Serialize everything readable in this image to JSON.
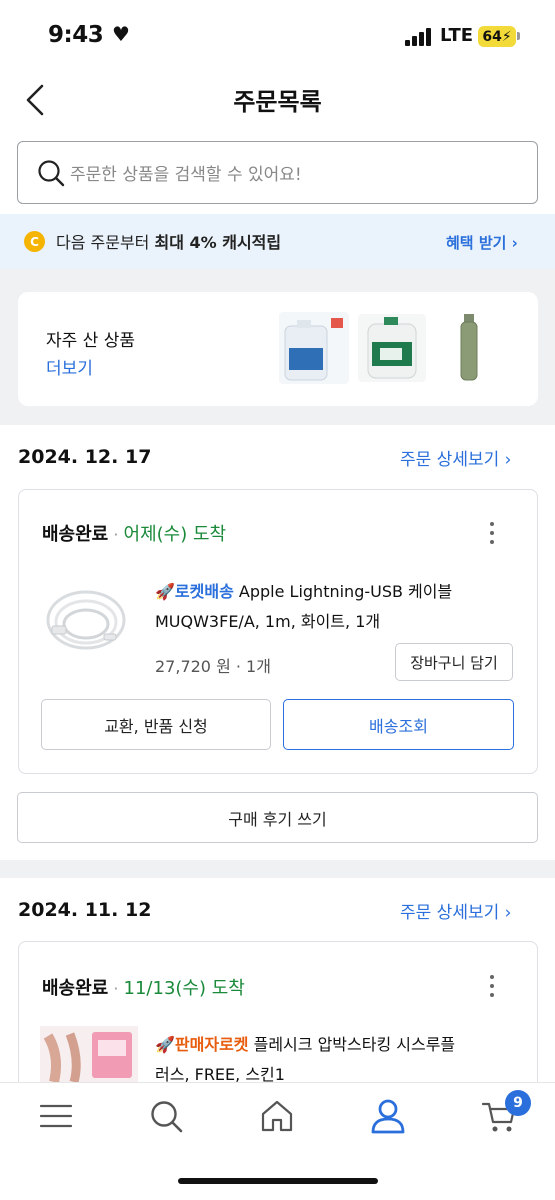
{
  "status_bar": {
    "time": "9:43",
    "network": "LTE",
    "battery": "64"
  },
  "header": {
    "title": "주문목록"
  },
  "search": {
    "placeholder": "주문한 상품을 검색할 수 있어요!"
  },
  "banner": {
    "coin": "C",
    "text_prefix": "다음 주문부터 ",
    "text_bold": "최대 4% 캐시적립",
    "link": "혜택 받기 ›"
  },
  "frequent": {
    "title": "자주 산 상품",
    "more": "더보기"
  },
  "orders": [
    {
      "date": "2024. 12. 17",
      "detail_link": "주문 상세보기 ›",
      "status": "배송완료",
      "arrival": "어제(수) 도착",
      "badge": "🚀로켓배송",
      "product_line1": " Apple Lightning-USB 케이블",
      "product_line2": "MUQW3FE/A, 1m, 화이트, 1개",
      "price": "27,720 원 · 1개",
      "cart_button": "장바구니 담기",
      "exchange_button": "교환, 반품 신청",
      "tracking_button": "배송조회",
      "review_button": "구매 후기 쓰기"
    },
    {
      "date": "2024. 11. 12",
      "detail_link": "주문 상세보기 ›",
      "status": "배송완료",
      "arrival": "11/13(수) 도착",
      "badge": "🚀판매자로켓",
      "product_line1": " 플레시크 압박스타킹 시스루플",
      "product_line2": "러스, FREE, 스킨1"
    }
  ],
  "tabbar": {
    "cart_count": "9"
  },
  "colors": {
    "accent": "#2a6fdb",
    "arrival_green": "#1a8a3a",
    "seller_orange": "#e85c0d"
  }
}
